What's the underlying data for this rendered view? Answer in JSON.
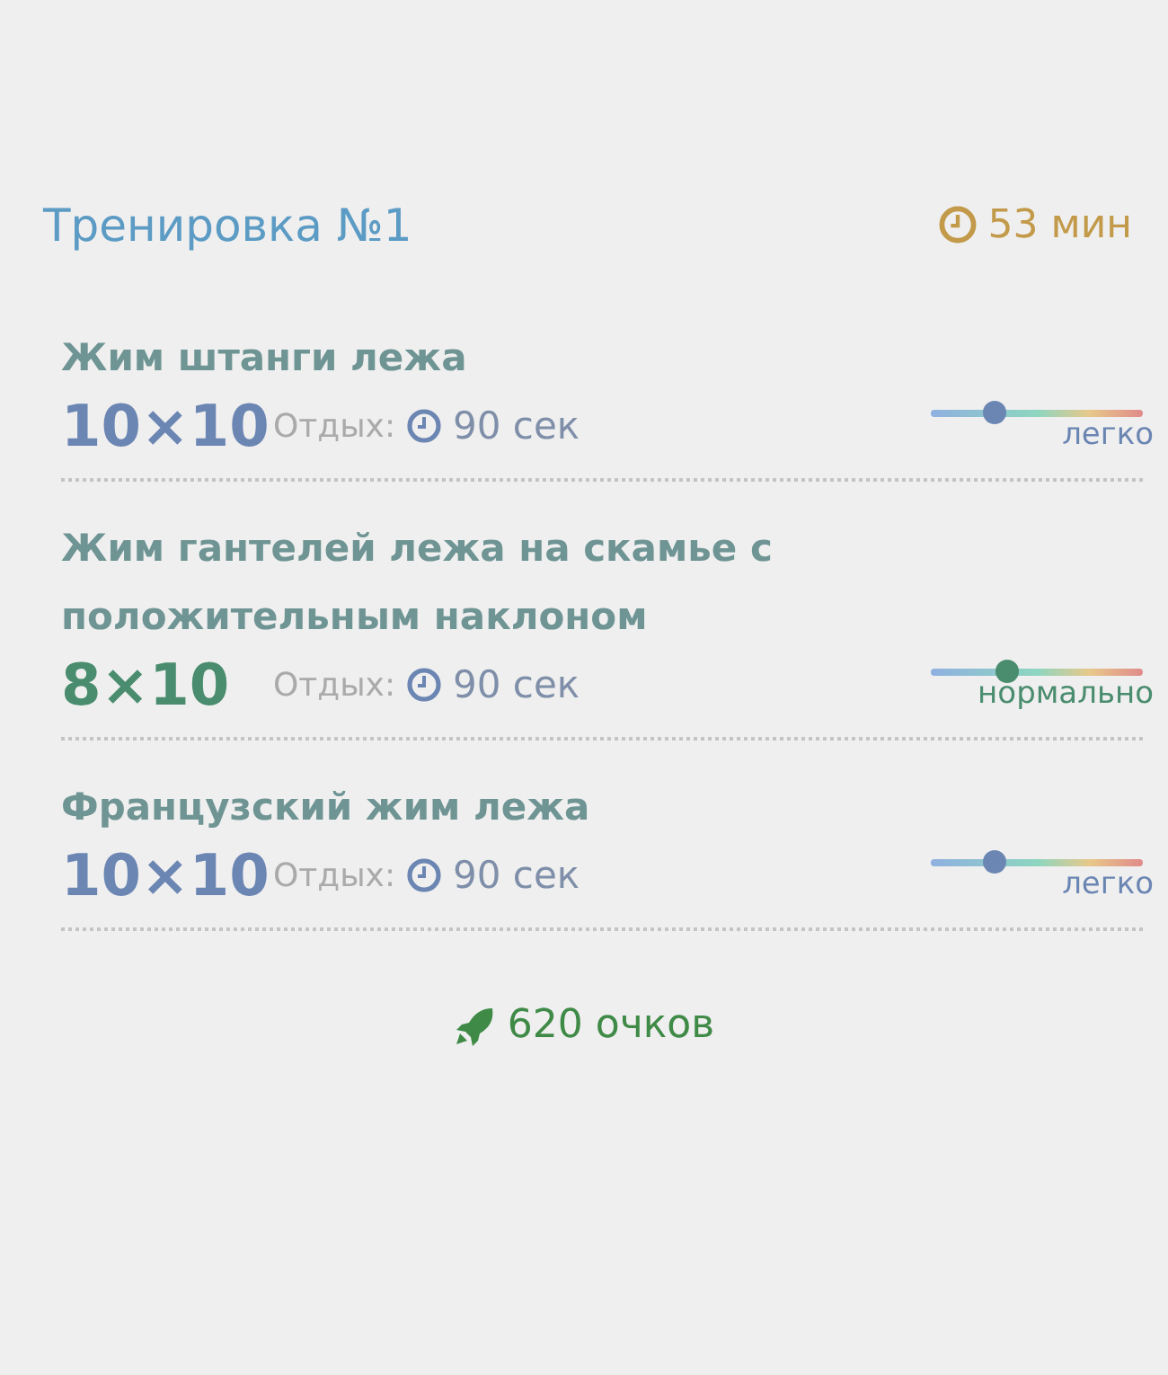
{
  "workout": {
    "title": "Тренировка №1",
    "duration": "53 мин"
  },
  "exercises": [
    {
      "name": "Жим штанги лежа",
      "sets": "10×10",
      "rest_label": "Отдых:",
      "rest": "90 сек",
      "level": 0.3,
      "difficulty": "легко",
      "color": "#6b86b3"
    },
    {
      "name": "Жим гантелей лежа на скамье с положительным наклоном",
      "sets": "8×10",
      "rest_label": "Отдых:",
      "rest": "90 сек",
      "level": 0.36,
      "difficulty": "нормально",
      "color": "#4a8c6e"
    },
    {
      "name": "Французский жим лежа",
      "sets": "10×10",
      "rest_label": "Отдых:",
      "rest": "90 сек",
      "level": 0.3,
      "difficulty": "легко",
      "color": "#6b86b3"
    }
  ],
  "score": "620 очков"
}
